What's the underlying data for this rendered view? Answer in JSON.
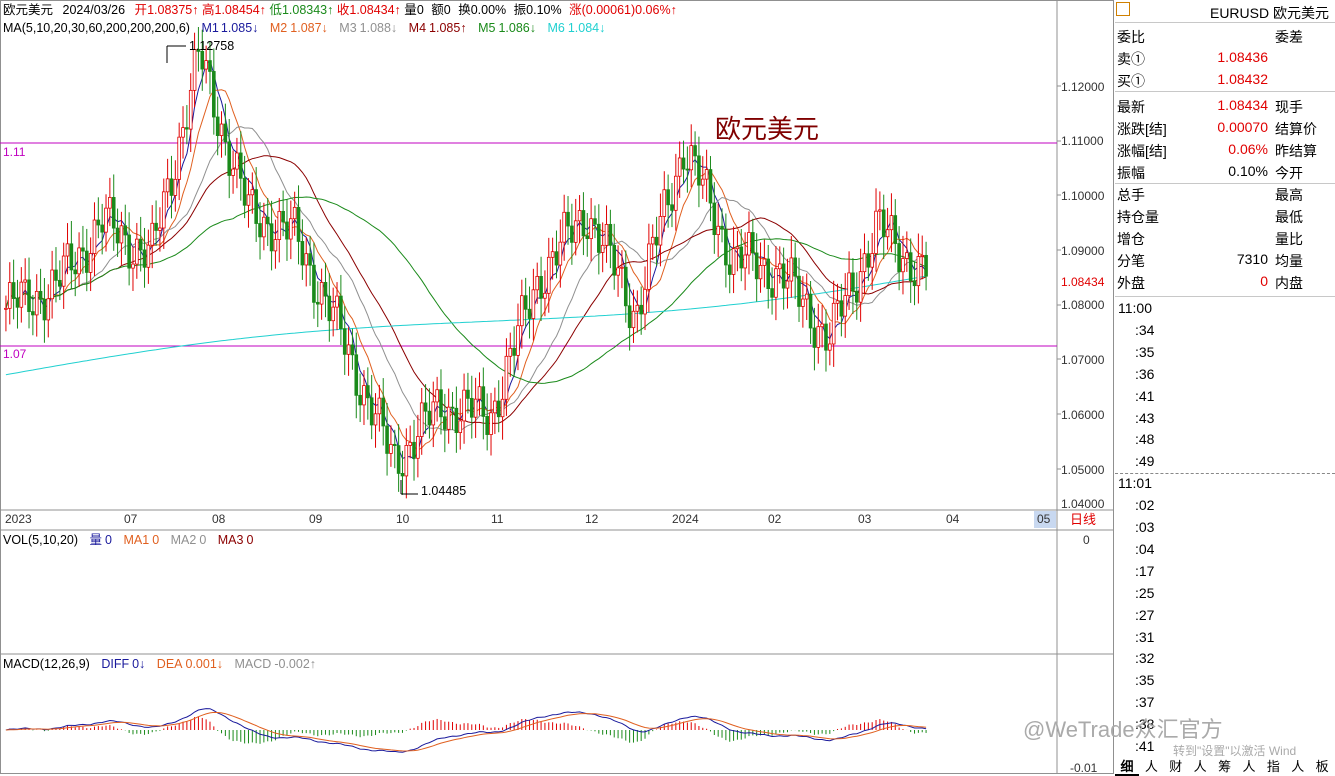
{
  "header": {
    "title": "欧元美元",
    "date": "2024/03/26",
    "open_label": "开",
    "open": "1.08375↑",
    "high_label": "高",
    "high": "1.08454↑",
    "low_label": "低",
    "low": "1.08343↑",
    "close_label": "收",
    "close": "1.08434↑",
    "vol_label": "量",
    "vol": "0",
    "amt_label": "额",
    "amt": "0",
    "turn_label": "换",
    "turn": "0.00%",
    "amp_label": "振",
    "amp": "0.10%",
    "chg_label": "涨",
    "chg": "(0.00061)0.06%↑"
  },
  "ma_legend": {
    "label": "MA(5,10,20,30,60,200,200,200,6)",
    "items": [
      {
        "name": "M1",
        "value": "1.085↓",
        "color": "#1a1a9c"
      },
      {
        "name": "M2",
        "value": "1.087↓",
        "color": "#e06020"
      },
      {
        "name": "M3",
        "value": "1.088↓",
        "color": "#909090"
      },
      {
        "name": "M4",
        "value": "1.085↑",
        "color": "#8b0000"
      },
      {
        "name": "M5",
        "value": "1.086↓",
        "color": "#1a8a1a"
      },
      {
        "name": "M6",
        "value": "1.084↓",
        "color": "#20d0d0"
      }
    ]
  },
  "annotations": {
    "max": "1.12758",
    "min": "1.04485",
    "hline_top": "1.11",
    "hline_bottom": "1.07",
    "watermark": "欧元美元",
    "last_price": "1.08434",
    "cycle": "日线"
  },
  "chart_data": [
    {
      "type": "candlestick",
      "title": "欧元美元",
      "yaxis": {
        "ticks": [
          "1.12000",
          "1.11000",
          "1.10000",
          "1.09000",
          "1.08000",
          "1.07000",
          "1.06000",
          "1.05000",
          "1.04000"
        ],
        "ylim": [
          1.0385,
          1.1337
        ]
      },
      "xaxis": {
        "ticks": [
          "2023",
          "07",
          "08",
          "09",
          "10",
          "11",
          "12",
          "2024",
          "02",
          "03",
          "04",
          "05"
        ]
      },
      "close_anchors": [
        {
          "date": "2023-05",
          "close": 1.078
        },
        {
          "date": "2023-06",
          "close": 1.082
        },
        {
          "date": "2023-06-20",
          "close": 1.095
        },
        {
          "date": "2023-07-03",
          "close": 1.088
        },
        {
          "date": "2023-07-18",
          "close": 1.1275
        },
        {
          "date": "2023-08-10",
          "close": 1.097
        },
        {
          "date": "2023-08-30",
          "close": 1.092
        },
        {
          "date": "2023-09-20",
          "close": 1.071
        },
        {
          "date": "2023-10-03",
          "close": 1.048
        },
        {
          "date": "2023-10-20",
          "close": 1.059
        },
        {
          "date": "2023-11-01",
          "close": 1.057
        },
        {
          "date": "2023-11-15",
          "close": 1.084
        },
        {
          "date": "2023-11-29",
          "close": 1.097
        },
        {
          "date": "2023-12-08",
          "close": 1.077
        },
        {
          "date": "2023-12-28",
          "close": 1.11
        },
        {
          "date": "2024-01-15",
          "close": 1.088
        },
        {
          "date": "2024-02-01",
          "close": 1.085
        },
        {
          "date": "2024-02-14",
          "close": 1.072
        },
        {
          "date": "2024-03-08",
          "close": 1.094
        },
        {
          "date": "2024-03-26",
          "close": 1.0843
        }
      ],
      "horizontal_lines": [
        1.11,
        1.0727
      ]
    },
    {
      "type": "bar",
      "title": "VOL(5,10,20)",
      "series": [
        {
          "name": "量",
          "value": "0"
        },
        {
          "name": "MA1",
          "value": "0"
        },
        {
          "name": "MA2",
          "value": "0"
        },
        {
          "name": "MA3",
          "value": "0"
        }
      ],
      "yaxis": {
        "ticks": [
          "0"
        ]
      }
    },
    {
      "type": "line",
      "title": "MACD(12,26,9)",
      "series": [
        {
          "name": "DIFF",
          "value": "0↓"
        },
        {
          "name": "DEA",
          "value": "0.001↓"
        },
        {
          "name": "MACD",
          "value": "-0.002↑"
        }
      ],
      "yaxis": {
        "ticks": [
          "-0.01"
        ]
      }
    }
  ],
  "panel": {
    "symbol": "EURUSD 欧元美元",
    "rows": [
      {
        "k": "委比",
        "v": "",
        "k2": "委差"
      },
      {
        "k": "卖①",
        "v": "1.08436",
        "k2": ""
      },
      {
        "k": "买①",
        "v": "1.08432",
        "k2": ""
      },
      {
        "k": "最新",
        "v": "1.08434",
        "k2": "现手"
      },
      {
        "k": "涨跌[结]",
        "v": "0.00070",
        "k2": "结算价"
      },
      {
        "k": "涨幅[结]",
        "v": "0.06%",
        "k2": "昨结算"
      },
      {
        "k": "振幅",
        "v": "0.10%",
        "k2": "今开"
      },
      {
        "k": "总手",
        "v": "",
        "k2": "最高"
      },
      {
        "k": "持仓量",
        "v": "",
        "k2": "最低"
      },
      {
        "k": "增仓",
        "v": "",
        "k2": "量比"
      },
      {
        "k": "分笔",
        "v": "7310",
        "k2": "均量"
      },
      {
        "k": "外盘",
        "v": "0",
        "k2": "内盘"
      }
    ],
    "times": [
      "11:00",
      ":34",
      ":35",
      ":36",
      ":41",
      ":43",
      ":48",
      ":49",
      "11:01",
      ":02",
      ":03",
      ":04",
      ":17",
      ":25",
      ":27",
      ":31",
      ":32",
      ":35",
      ":37",
      ":38",
      ":41"
    ],
    "tabs": [
      "细",
      "人",
      "财",
      "人",
      "筹",
      "人",
      "指",
      "人",
      "板"
    ],
    "overlay_watermark": "@WeTrade众汇官方",
    "activation": "转到\"设置\"以激活 Wind"
  }
}
